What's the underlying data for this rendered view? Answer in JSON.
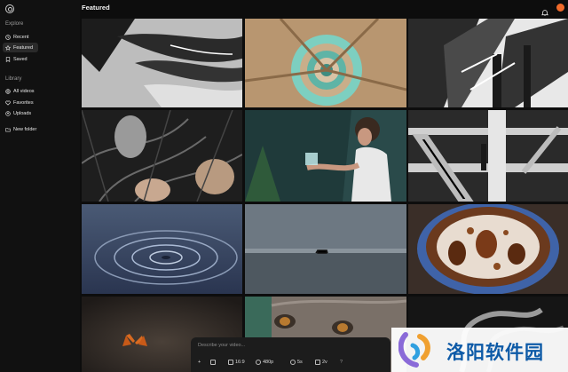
{
  "sidebar": {
    "explore_label": "Explore",
    "explore_items": [
      {
        "label": "Recent",
        "icon": "clock-icon",
        "active": false
      },
      {
        "label": "Featured",
        "icon": "star-icon",
        "active": true
      },
      {
        "label": "Saved",
        "icon": "bookmark-icon",
        "active": false
      }
    ],
    "library_label": "Library",
    "library_items": [
      {
        "label": "All videos",
        "icon": "globe-icon"
      },
      {
        "label": "Favorites",
        "icon": "heart-icon"
      },
      {
        "label": "Uploads",
        "icon": "upload-icon"
      }
    ],
    "new_folder_label": "New folder"
  },
  "header": {
    "title": "Featured",
    "avatar_color": "#f06a2a"
  },
  "grid": {
    "tiles": [
      {
        "name": "feathers-video"
      },
      {
        "name": "spiral-paper-video"
      },
      {
        "name": "architecture-video"
      },
      {
        "name": "leaves-video"
      },
      {
        "name": "woman-ice-cube-video"
      },
      {
        "name": "wooden-structure-video"
      },
      {
        "name": "water-ripple-video"
      },
      {
        "name": "beach-piano-video"
      },
      {
        "name": "coffee-cup-video"
      },
      {
        "name": "butterfly-video"
      },
      {
        "name": "animal-eyes-video"
      },
      {
        "name": "smoke-video"
      }
    ]
  },
  "prompt": {
    "placeholder": "Describe your video...",
    "add_label": "+",
    "aspect_label": "16:9",
    "resolution_label": "480p",
    "duration_label": "5s",
    "variations_label": "2v",
    "help_label": "?"
  },
  "watermark": {
    "text": "洛阳软件园"
  }
}
